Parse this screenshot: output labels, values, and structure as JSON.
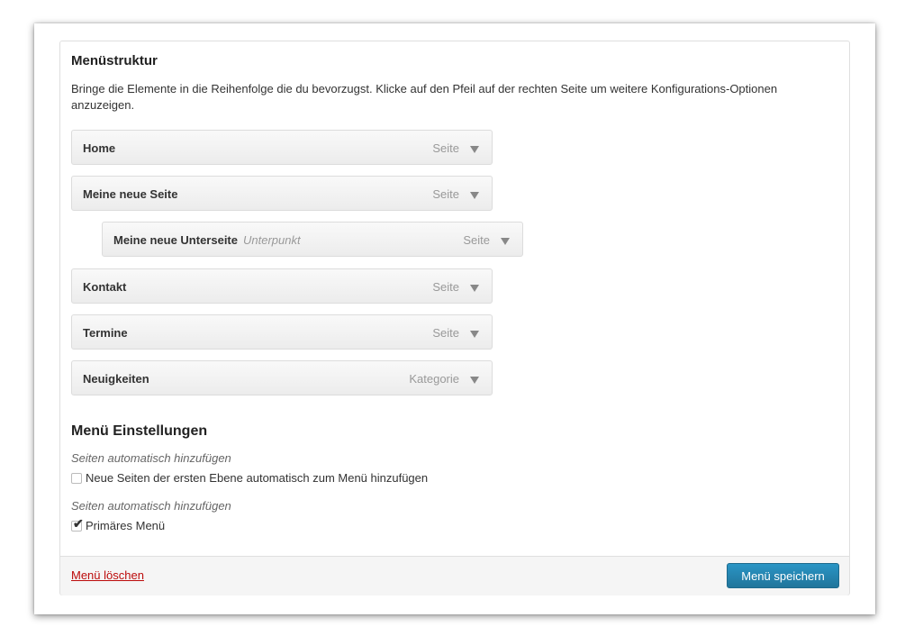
{
  "structure": {
    "title": "Menüstruktur",
    "description": "Bringe die Elemente in die Reihenfolge die du bevorzugst. Klicke auf den Pfeil auf der rechten Seite um weitere Konfigurations-Optionen anzuzeigen."
  },
  "items": [
    {
      "title": "Home",
      "subtitle": "",
      "type": "Seite"
    },
    {
      "title": "Meine neue Seite",
      "subtitle": "",
      "type": "Seite"
    },
    {
      "title": "Meine neue Unterseite",
      "subtitle": "Unterpunkt",
      "type": "Seite"
    },
    {
      "title": "Kontakt",
      "subtitle": "",
      "type": "Seite"
    },
    {
      "title": "Termine",
      "subtitle": "",
      "type": "Seite"
    },
    {
      "title": "Neuigkeiten",
      "subtitle": "",
      "type": "Kategorie"
    }
  ],
  "settings": {
    "title": "Menü Einstellungen",
    "auto_add_label": "Seiten automatisch hinzufügen",
    "auto_add_option": "Neue Seiten der ersten Ebene automatisch zum Menü hinzufügen",
    "auto_add_checked": false,
    "location_label": "Seiten automatisch hinzufügen",
    "primary_option": "Primäres Menü",
    "primary_checked": true
  },
  "footer": {
    "delete_label": "Menü löschen",
    "save_label": "Menü speichern"
  },
  "icons": {
    "expand": "chevron-down-icon",
    "checkbox_check": "check-icon"
  },
  "colors": {
    "delete_link": "#bc0b0b",
    "save_button": "#21759b"
  }
}
